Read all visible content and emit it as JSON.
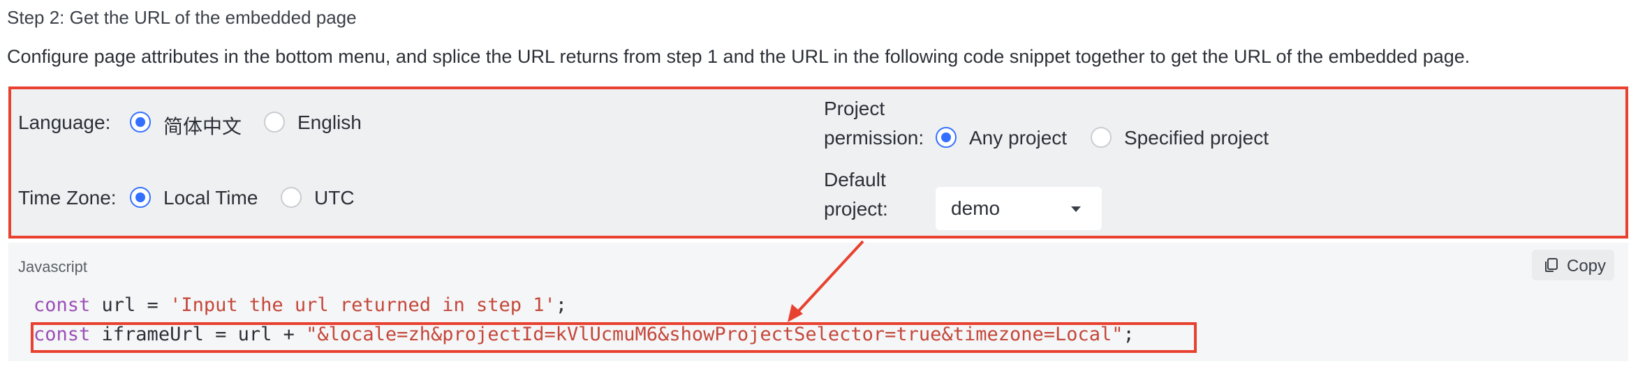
{
  "step": {
    "title": "Step 2: Get the URL of the embedded page",
    "description": "Configure page attributes in the bottom menu, and splice the URL returns from step 1 and the URL in the following code snippet together to get the URL of the embedded page."
  },
  "config": {
    "language": {
      "label": "Language:",
      "options": [
        {
          "label": "简体中文",
          "selected": true
        },
        {
          "label": "English",
          "selected": false
        }
      ]
    },
    "time_zone": {
      "label": "Time Zone:",
      "options": [
        {
          "label": "Local Time",
          "selected": true
        },
        {
          "label": "UTC",
          "selected": false
        }
      ]
    },
    "project_permission": {
      "label_line1": "Project",
      "label_line2": "permission:",
      "options": [
        {
          "label": "Any project",
          "selected": true
        },
        {
          "label": "Specified project",
          "selected": false
        }
      ]
    },
    "default_project": {
      "label_line1": "Default",
      "label_line2": "project:",
      "value": "demo"
    }
  },
  "code_block": {
    "language": "Javascript",
    "copy_label": "Copy",
    "line1": {
      "kw": "const",
      "rest": " url = ",
      "str": "'Input the url returned in step 1'",
      "end": ";"
    },
    "line2": {
      "kw": "const",
      "rest": " iframeUrl = url + ",
      "str": "\"&locale=zh&projectId=kVlUcmuM6&showProjectSelector=true&timezone=Local\"",
      "end": ";"
    }
  },
  "colors": {
    "accent": "#3370ff",
    "annotation": "#e8412f",
    "keyword": "#9b4fb6",
    "string": "#c4473a"
  }
}
